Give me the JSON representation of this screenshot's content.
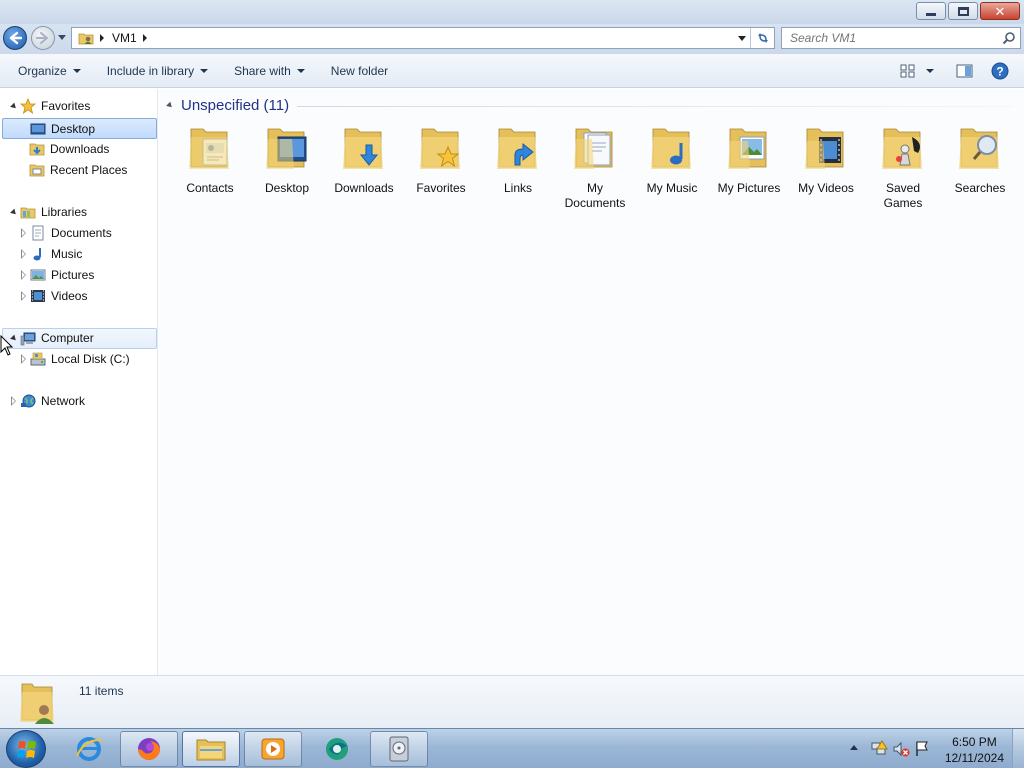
{
  "window": {
    "caption_buttons": [
      "minimize-icon",
      "restore-icon",
      "close-icon"
    ]
  },
  "address": {
    "crumbs": [
      "VM1"
    ],
    "search_placeholder": "Search VM1"
  },
  "commands": {
    "organize": "Organize",
    "include_in_library": "Include in library",
    "share_with": "Share with",
    "new_folder": "New folder"
  },
  "nav": {
    "favorites": "Favorites",
    "desktop": "Desktop",
    "downloads": "Downloads",
    "recent_places": "Recent Places",
    "libraries": "Libraries",
    "documents": "Documents",
    "music": "Music",
    "pictures": "Pictures",
    "videos": "Videos",
    "computer": "Computer",
    "local_disk": "Local Disk (C:)",
    "network": "Network"
  },
  "content": {
    "group_title": "Unspecified (11)",
    "items": [
      {
        "label": "Contacts",
        "icon": "contacts-folder-icon"
      },
      {
        "label": "Desktop",
        "icon": "desktop-folder-icon"
      },
      {
        "label": "Downloads",
        "icon": "downloads-folder-icon"
      },
      {
        "label": "Favorites",
        "icon": "favorites-folder-icon"
      },
      {
        "label": "Links",
        "icon": "links-folder-icon"
      },
      {
        "label": "My\nDocuments",
        "icon": "documents-folder-icon"
      },
      {
        "label": "My Music",
        "icon": "music-folder-icon"
      },
      {
        "label": "My Pictures",
        "icon": "pictures-folder-icon"
      },
      {
        "label": "My Videos",
        "icon": "videos-folder-icon"
      },
      {
        "label": "Saved\nGames",
        "icon": "saved-games-folder-icon"
      },
      {
        "label": "Searches",
        "icon": "searches-folder-icon"
      }
    ]
  },
  "details": {
    "count": "11 items"
  },
  "taskbar": {
    "time": "6:50 PM",
    "date": "12/11/2024"
  },
  "colors": {
    "group_header": "#1e3287",
    "selection": "#c1dbfc",
    "folder_yellow": "#f0d47a"
  }
}
